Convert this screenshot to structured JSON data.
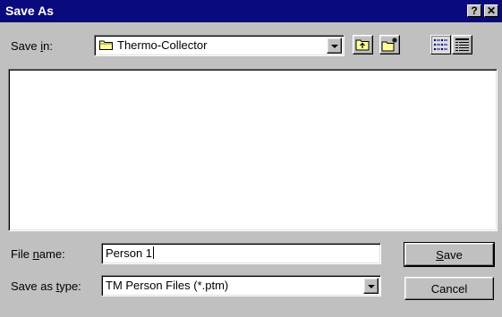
{
  "window": {
    "title": "Save As"
  },
  "title_buttons": {
    "help": "?",
    "close": "✕"
  },
  "save_in": {
    "label_pre": "Save ",
    "label_key": "i",
    "label_post": "n:",
    "value": "Thermo-Collector",
    "icon": "folder-icon"
  },
  "toolbar": {
    "up_one_level": "up-folder-icon",
    "new_folder": "new-folder-icon",
    "list_view": "list-view-icon",
    "details_view": "details-view-icon"
  },
  "file_list": {
    "items": []
  },
  "file_name": {
    "label_pre": "File ",
    "label_key": "n",
    "label_post": "ame:",
    "value": "Person 1"
  },
  "save_as_type": {
    "label_pre": "Save as ",
    "label_key": "t",
    "label_post": "ype:",
    "value": "TM Person Files (*.ptm)"
  },
  "buttons": {
    "save_key": "S",
    "save_rest": "ave",
    "cancel": "Cancel"
  },
  "colors": {
    "title_bar": "#0a0a7e",
    "face": "#c0c0c0",
    "field": "#ffffff"
  }
}
